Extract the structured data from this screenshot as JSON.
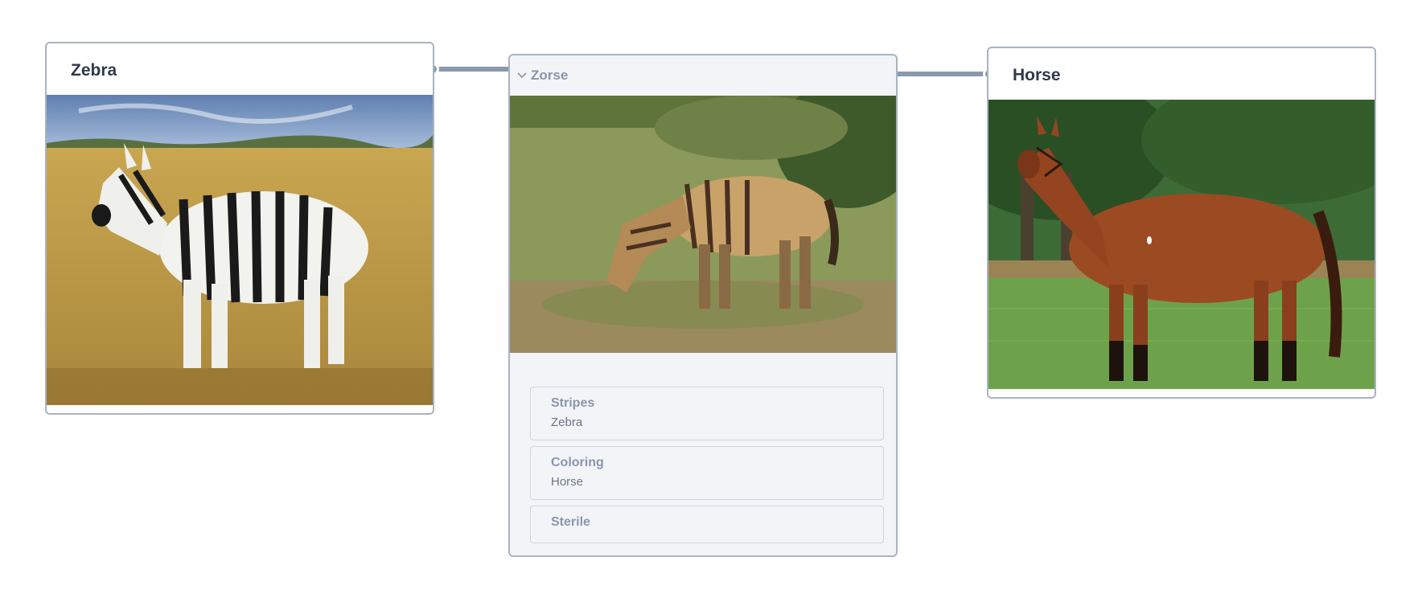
{
  "nodes": {
    "zebra": {
      "title": "Zebra"
    },
    "zorse": {
      "title": "Zorse",
      "properties": [
        {
          "name": "Stripes",
          "value": "Zebra"
        },
        {
          "name": "Coloring",
          "value": "Horse"
        },
        {
          "name": "Sterile",
          "value": ""
        }
      ]
    },
    "horse": {
      "title": "Horse"
    }
  },
  "colors": {
    "edge": "#8a98ad",
    "card_border": "#a9b3c2",
    "zorse_bg": "#f3f4f8",
    "title_text": "#2f3a4a",
    "muted_text": "#8a96aa"
  }
}
